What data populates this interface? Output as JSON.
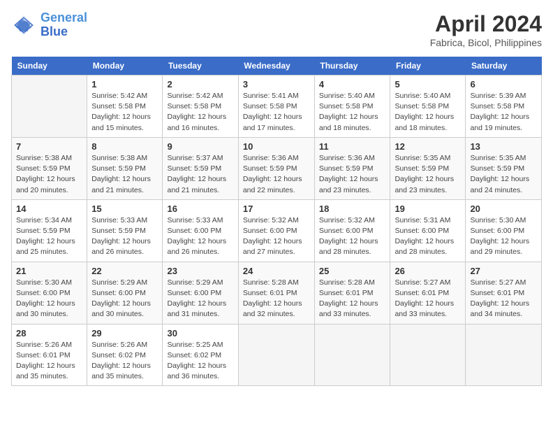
{
  "header": {
    "logo_line1": "General",
    "logo_line2": "Blue",
    "title": "April 2024",
    "subtitle": "Fabrica, Bicol, Philippines"
  },
  "days_of_week": [
    "Sunday",
    "Monday",
    "Tuesday",
    "Wednesday",
    "Thursday",
    "Friday",
    "Saturday"
  ],
  "weeks": [
    [
      {
        "day": "",
        "info": ""
      },
      {
        "day": "1",
        "info": "Sunrise: 5:42 AM\nSunset: 5:58 PM\nDaylight: 12 hours\nand 15 minutes."
      },
      {
        "day": "2",
        "info": "Sunrise: 5:42 AM\nSunset: 5:58 PM\nDaylight: 12 hours\nand 16 minutes."
      },
      {
        "day": "3",
        "info": "Sunrise: 5:41 AM\nSunset: 5:58 PM\nDaylight: 12 hours\nand 17 minutes."
      },
      {
        "day": "4",
        "info": "Sunrise: 5:40 AM\nSunset: 5:58 PM\nDaylight: 12 hours\nand 18 minutes."
      },
      {
        "day": "5",
        "info": "Sunrise: 5:40 AM\nSunset: 5:58 PM\nDaylight: 12 hours\nand 18 minutes."
      },
      {
        "day": "6",
        "info": "Sunrise: 5:39 AM\nSunset: 5:58 PM\nDaylight: 12 hours\nand 19 minutes."
      }
    ],
    [
      {
        "day": "7",
        "info": "Sunrise: 5:38 AM\nSunset: 5:59 PM\nDaylight: 12 hours\nand 20 minutes."
      },
      {
        "day": "8",
        "info": "Sunrise: 5:38 AM\nSunset: 5:59 PM\nDaylight: 12 hours\nand 21 minutes."
      },
      {
        "day": "9",
        "info": "Sunrise: 5:37 AM\nSunset: 5:59 PM\nDaylight: 12 hours\nand 21 minutes."
      },
      {
        "day": "10",
        "info": "Sunrise: 5:36 AM\nSunset: 5:59 PM\nDaylight: 12 hours\nand 22 minutes."
      },
      {
        "day": "11",
        "info": "Sunrise: 5:36 AM\nSunset: 5:59 PM\nDaylight: 12 hours\nand 23 minutes."
      },
      {
        "day": "12",
        "info": "Sunrise: 5:35 AM\nSunset: 5:59 PM\nDaylight: 12 hours\nand 23 minutes."
      },
      {
        "day": "13",
        "info": "Sunrise: 5:35 AM\nSunset: 5:59 PM\nDaylight: 12 hours\nand 24 minutes."
      }
    ],
    [
      {
        "day": "14",
        "info": "Sunrise: 5:34 AM\nSunset: 5:59 PM\nDaylight: 12 hours\nand 25 minutes."
      },
      {
        "day": "15",
        "info": "Sunrise: 5:33 AM\nSunset: 5:59 PM\nDaylight: 12 hours\nand 26 minutes."
      },
      {
        "day": "16",
        "info": "Sunrise: 5:33 AM\nSunset: 6:00 PM\nDaylight: 12 hours\nand 26 minutes."
      },
      {
        "day": "17",
        "info": "Sunrise: 5:32 AM\nSunset: 6:00 PM\nDaylight: 12 hours\nand 27 minutes."
      },
      {
        "day": "18",
        "info": "Sunrise: 5:32 AM\nSunset: 6:00 PM\nDaylight: 12 hours\nand 28 minutes."
      },
      {
        "day": "19",
        "info": "Sunrise: 5:31 AM\nSunset: 6:00 PM\nDaylight: 12 hours\nand 28 minutes."
      },
      {
        "day": "20",
        "info": "Sunrise: 5:30 AM\nSunset: 6:00 PM\nDaylight: 12 hours\nand 29 minutes."
      }
    ],
    [
      {
        "day": "21",
        "info": "Sunrise: 5:30 AM\nSunset: 6:00 PM\nDaylight: 12 hours\nand 30 minutes."
      },
      {
        "day": "22",
        "info": "Sunrise: 5:29 AM\nSunset: 6:00 PM\nDaylight: 12 hours\nand 30 minutes."
      },
      {
        "day": "23",
        "info": "Sunrise: 5:29 AM\nSunset: 6:00 PM\nDaylight: 12 hours\nand 31 minutes."
      },
      {
        "day": "24",
        "info": "Sunrise: 5:28 AM\nSunset: 6:01 PM\nDaylight: 12 hours\nand 32 minutes."
      },
      {
        "day": "25",
        "info": "Sunrise: 5:28 AM\nSunset: 6:01 PM\nDaylight: 12 hours\nand 33 minutes."
      },
      {
        "day": "26",
        "info": "Sunrise: 5:27 AM\nSunset: 6:01 PM\nDaylight: 12 hours\nand 33 minutes."
      },
      {
        "day": "27",
        "info": "Sunrise: 5:27 AM\nSunset: 6:01 PM\nDaylight: 12 hours\nand 34 minutes."
      }
    ],
    [
      {
        "day": "28",
        "info": "Sunrise: 5:26 AM\nSunset: 6:01 PM\nDaylight: 12 hours\nand 35 minutes."
      },
      {
        "day": "29",
        "info": "Sunrise: 5:26 AM\nSunset: 6:02 PM\nDaylight: 12 hours\nand 35 minutes."
      },
      {
        "day": "30",
        "info": "Sunrise: 5:25 AM\nSunset: 6:02 PM\nDaylight: 12 hours\nand 36 minutes."
      },
      {
        "day": "",
        "info": ""
      },
      {
        "day": "",
        "info": ""
      },
      {
        "day": "",
        "info": ""
      },
      {
        "day": "",
        "info": ""
      }
    ]
  ]
}
